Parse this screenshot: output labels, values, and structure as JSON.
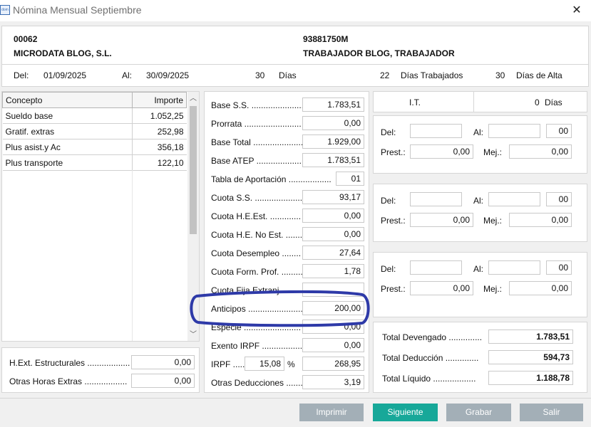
{
  "window": {
    "title": "Nómina Mensual Septiembre",
    "icon_text": "dom"
  },
  "header": {
    "company_code": "00062",
    "company_name": "MICRODATA BLOG, S.L.",
    "worker_id": "93881750M",
    "worker_name": "TRABAJADOR BLOG, TRABAJADOR",
    "del_label": "Del:",
    "del_value": "01/09/2025",
    "al_label": "Al:",
    "al_value": "30/09/2025",
    "dias_count": "30",
    "dias_label": "Días",
    "dias_trab_count": "22",
    "dias_trab_label": "Días Trabajados",
    "dias_alta_count": "30",
    "dias_alta_label": "Días de Alta"
  },
  "concepts": {
    "col_concepto": "Concepto",
    "col_importe": "Importe",
    "rows": [
      {
        "concepto": "Sueldo base",
        "importe": "1.052,25"
      },
      {
        "concepto": "Gratif. extras",
        "importe": "252,98"
      },
      {
        "concepto": "Plus asist.y Ac",
        "importe": "356,18"
      },
      {
        "concepto": "Plus transporte",
        "importe": "122,10"
      }
    ]
  },
  "extras": {
    "hext_label": "H.Ext. Estructurales ..................",
    "hext_value": "0,00",
    "otras_label": "Otras Horas Extras ..................",
    "otras_value": "0,00"
  },
  "bases": {
    "base_ss_label": "Base S.S. .......................",
    "base_ss": "1.783,51",
    "prorrata_label": "Prorrata ........................",
    "prorrata": "0,00",
    "base_total_label": "Base Total .....................",
    "base_total": "1.929,00",
    "base_atep_label": "Base ATEP .....................",
    "base_atep": "1.783,51",
    "tabla_label": "Tabla de Aportación ..................",
    "tabla": "01",
    "cuota_ss_label": "Cuota S.S. .....................",
    "cuota_ss": "93,17",
    "cuota_he_est_label": "Cuota H.E.Est. .............",
    "cuota_he_est": "0,00",
    "cuota_he_noest_label": "Cuota H.E. No Est. .......",
    "cuota_he_noest": "0,00",
    "cuota_desempleo_label": "Cuota Desempleo ........",
    "cuota_desempleo": "27,64",
    "cuota_form_label": "Cuota Form. Prof. .........",
    "cuota_form": "1,78",
    "cuota_fija_label": "Cuota Fija Extranj",
    "cuota_fija": "",
    "anticipos_label": "Anticipos ........................",
    "anticipos": "200,00",
    "especie_label": "Especie ........................",
    "especie": "0,00",
    "exento_label": "Exento IRPF .................",
    "exento": "0,00",
    "irpf_label": "IRPF ......",
    "irpf_pct": "15,08",
    "pct_sign": "%",
    "irpf_amount": "268,95",
    "otras_ded_label": "Otras Deducciones .......",
    "otras_ded": "3,19"
  },
  "it": {
    "label": "I.T.",
    "days": "0",
    "days_label": "Días"
  },
  "it_blocks": [
    {
      "del_label": "Del:",
      "del": "",
      "al_label": "Al:",
      "al": "",
      "code": "00",
      "prest_label": "Prest.:",
      "prest": "0,00",
      "mej_label": "Mej.:",
      "mej": "0,00"
    },
    {
      "del_label": "Del:",
      "del": "",
      "al_label": "Al:",
      "al": "",
      "code": "00",
      "prest_label": "Prest.:",
      "prest": "0,00",
      "mej_label": "Mej.:",
      "mej": "0,00"
    },
    {
      "del_label": "Del:",
      "del": "",
      "al_label": "Al:",
      "al": "",
      "code": "00",
      "prest_label": "Prest.:",
      "prest": "0,00",
      "mej_label": "Mej.:",
      "mej": "0,00"
    }
  ],
  "totals": {
    "devengado_label": "Total Devengado ..............",
    "devengado": "1.783,51",
    "deduccion_label": "Total Deducción ..............",
    "deduccion": "594,73",
    "liquido_label": "Total Líquido ..................",
    "liquido": "1.188,78"
  },
  "buttons": {
    "imprimir": "Imprimir",
    "siguiente": "Siguiente",
    "grabar": "Grabar",
    "salir": "Salir"
  },
  "colors": {
    "highlight_ring": "#2e3aa8",
    "primary_button": "#17a899",
    "secondary_button": "#a3afb7"
  }
}
